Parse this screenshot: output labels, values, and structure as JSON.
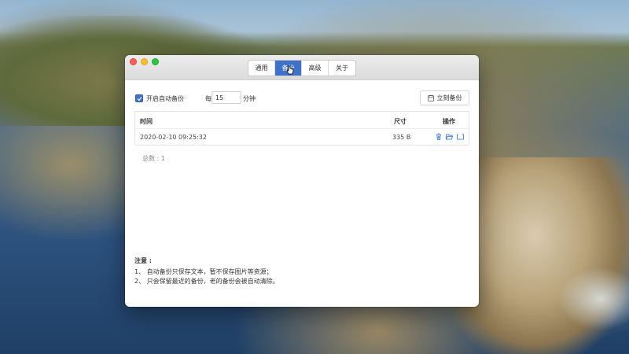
{
  "window": {
    "tabs": [
      "通用",
      "备份",
      "高级",
      "关于"
    ],
    "active_tab_index": 1
  },
  "backup": {
    "auto_backup_label": "开启自动备份",
    "auto_backup_checked": true,
    "every_label": "每",
    "interval_value": "15",
    "minutes_label": "分钟",
    "backup_now_label": "立刻备份"
  },
  "table": {
    "headers": {
      "time": "时间",
      "size": "尺寸",
      "actions": "操作"
    },
    "rows": [
      {
        "time": "2020-02-10 09:25:32",
        "size": "335 B"
      }
    ],
    "row_action_icons": [
      "trash-icon",
      "folder-open-icon",
      "restore-icon"
    ]
  },
  "total_label": "总数 : 1",
  "notes": {
    "title": "注意 :",
    "items": [
      "1、 自动备份只保存文本，暂不保存图片等资源；",
      "2、 只会保留最近的备份，老的备份会被自动清除。"
    ]
  },
  "colors": {
    "accent": "#3d72c8",
    "traffic_red": "#fe5f57",
    "traffic_yellow": "#febc2e",
    "traffic_green": "#28c840"
  }
}
